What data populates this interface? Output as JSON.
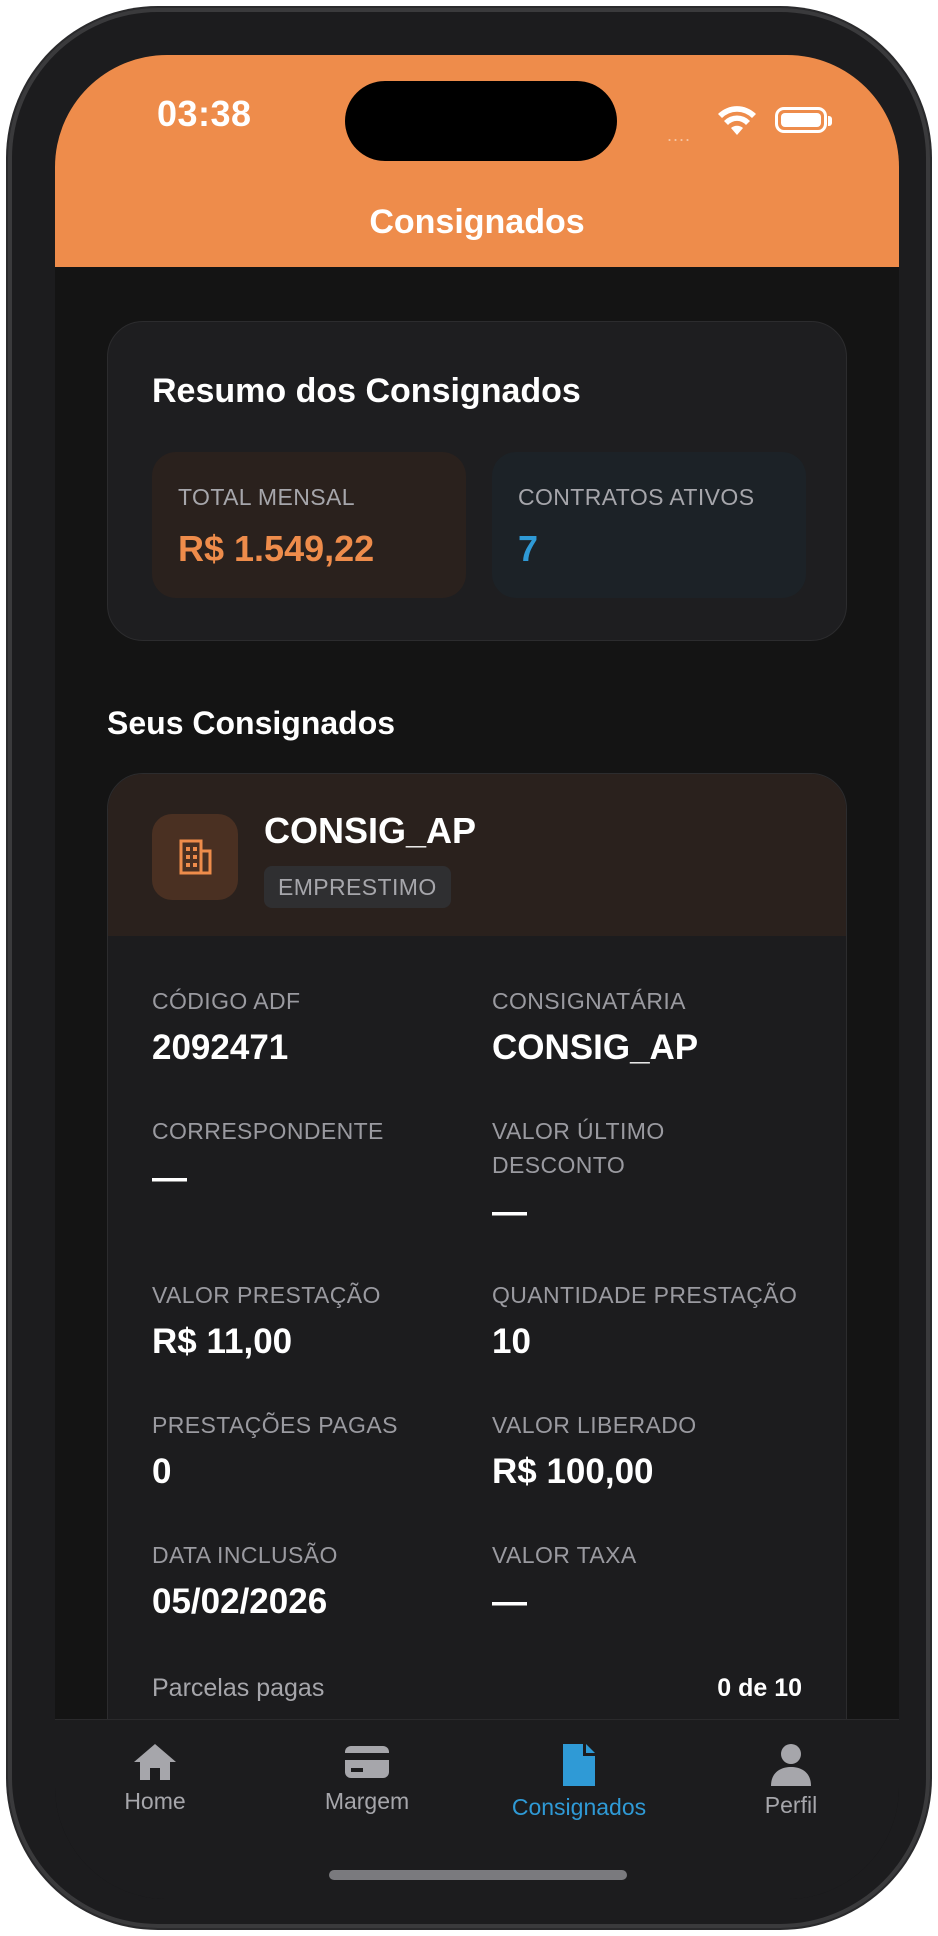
{
  "status_bar": {
    "time": "03:38",
    "signal": "....",
    "wifi_icon": "wifi-icon",
    "battery_icon": "battery-icon"
  },
  "header": {
    "title": "Consignados",
    "color": "#ee8c4b"
  },
  "summary": {
    "title": "Resumo dos Consignados",
    "total_label": "TOTAL MENSAL",
    "total_value": "R$ 1.549,22",
    "total_color": "#ee8c4b",
    "contracts_label": "CONTRATOS ATIVOS",
    "contracts_value": "7",
    "contracts_color": "#2f9ad6"
  },
  "list": {
    "title": "Seus Consignados",
    "items": [
      {
        "icon": "building-icon",
        "name": "CONSIG_AP",
        "type": "EMPRESTIMO",
        "fields": [
          {
            "label": "CÓDIGO ADF",
            "value": "2092471"
          },
          {
            "label": "CONSIGNATÁRIA",
            "value": "CONSIG_AP"
          },
          {
            "label": "CORRESPONDENTE",
            "value": "—"
          },
          {
            "label": "VALOR ÚLTIMO DESCONTO",
            "value": "—"
          },
          {
            "label": "VALOR PRESTAÇÃO",
            "value": "R$ 11,00"
          },
          {
            "label": "QUANTIDADE PRESTAÇÃO",
            "value": "10"
          },
          {
            "label": "PRESTAÇÕES PAGAS",
            "value": "0"
          },
          {
            "label": "VALOR LIBERADO",
            "value": "R$ 100,00"
          },
          {
            "label": "DATA INCLUSÃO",
            "value": "05/02/2026"
          },
          {
            "label": "VALOR TAXA",
            "value": "—"
          }
        ],
        "progress_label": "Parcelas pagas",
        "progress_value": "0 de 10"
      }
    ]
  },
  "tabs": [
    {
      "label": "Home",
      "icon": "home-icon",
      "active": false
    },
    {
      "label": "Margem",
      "icon": "card-icon",
      "active": false
    },
    {
      "label": "Consignados",
      "icon": "document-icon",
      "active": true
    },
    {
      "label": "Perfil",
      "icon": "person-icon",
      "active": false
    }
  ]
}
